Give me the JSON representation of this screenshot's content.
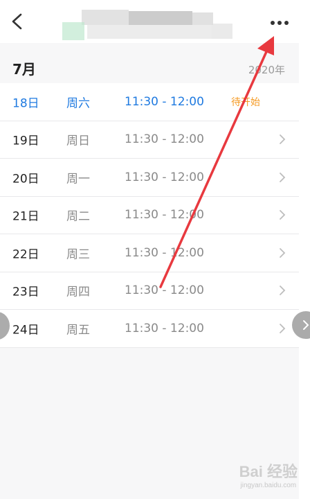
{
  "header": {
    "back_icon": "back-arrow-icon",
    "more_icon": "more-dots-icon"
  },
  "month_header": {
    "month": "7月",
    "year": "2020年"
  },
  "schedule": [
    {
      "day": "18日",
      "weekday": "周六",
      "time": "11:30 - 12:00",
      "status": "待开始",
      "active": true
    },
    {
      "day": "19日",
      "weekday": "周日",
      "time": "11:30 - 12:00",
      "status": "",
      "active": false
    },
    {
      "day": "20日",
      "weekday": "周一",
      "time": "11:30 - 12:00",
      "status": "",
      "active": false
    },
    {
      "day": "21日",
      "weekday": "周二",
      "time": "11:30 - 12:00",
      "status": "",
      "active": false
    },
    {
      "day": "22日",
      "weekday": "周三",
      "time": "11:30 - 12:00",
      "status": "",
      "active": false
    },
    {
      "day": "23日",
      "weekday": "周四",
      "time": "11:30 - 12:00",
      "status": "",
      "active": false
    },
    {
      "day": "24日",
      "weekday": "周五",
      "time": "11:30 - 12:00",
      "status": "",
      "active": false
    }
  ],
  "colors": {
    "accent_blue": "#1f7ae0",
    "status_orange": "#f59a23",
    "annotation_red": "#e8393f"
  },
  "watermark": {
    "main": "Bai 经验",
    "sub": "jingyan.baidu.com"
  }
}
